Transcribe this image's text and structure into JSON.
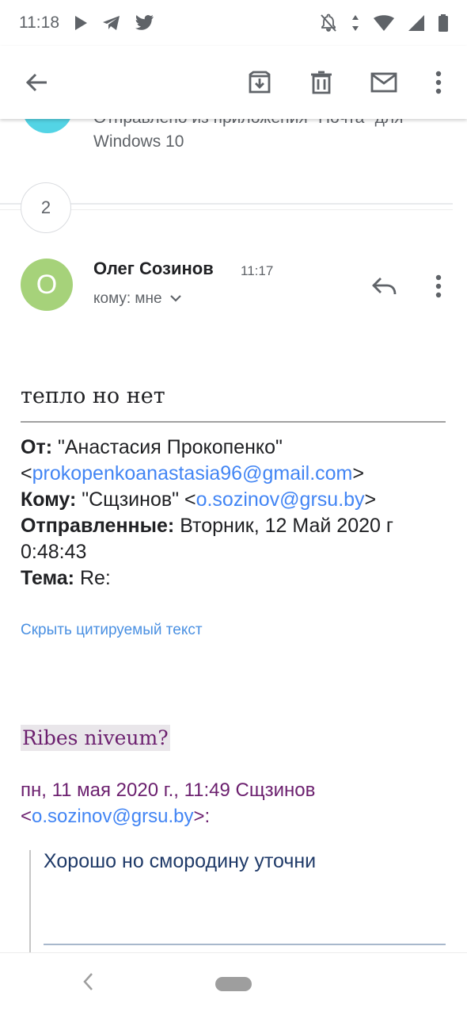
{
  "statusbar": {
    "time": "11:18"
  },
  "thread": {
    "prev_snippet_line1": "Отправлено из приложения \"Почта\" для",
    "prev_snippet_line2": "Windows 10",
    "collapsed_count": "2"
  },
  "message": {
    "avatar_letter": "О",
    "sender": "Олег Созинов",
    "time": "11:17",
    "recipient": "кому: мне",
    "body": "тепло но нет",
    "headers": {
      "from_label": "От:",
      "from_name": " \"Анастасия Прокопенко\"",
      "from_email": "prokopenkoanastasia96@gmail.com",
      "to_label": "Кому:",
      "to_name": " \"Сщзинов\" ",
      "to_email": "o.sozinov@grsu.by",
      "sent_label": "Отправленные:",
      "sent_value": " Вторник, 12 Май 2020 г 0:48:43",
      "subject_label": "Тема:",
      "subject_value": " Re:"
    },
    "hide_quoted": "Скрыть цитируемый текст",
    "quoted": {
      "question": "Ribes niveum?",
      "attribution": "пн, 11 мая 2020 г., 11:49 Сщзинов",
      "attribution_email": "o.sozinov@grsu.by",
      "text": "Хорошо но смородину уточни"
    }
  },
  "icons": {
    "back": "back-arrow-icon",
    "archive": "archive-icon",
    "delete": "delete-icon",
    "mark_unread": "mail-icon",
    "more": "more-vert-icon",
    "reply": "reply-icon"
  },
  "colors": {
    "link": "#4285f4",
    "avatar_bg": "#a6d27a",
    "prev_avatar_bg": "#53d4e5",
    "quoted_purple": "#6b1f6e"
  }
}
